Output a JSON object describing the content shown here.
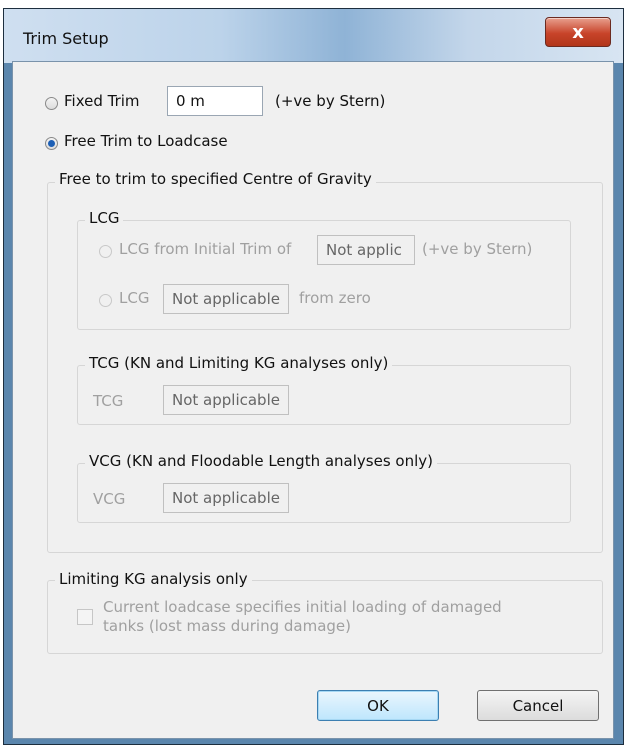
{
  "window": {
    "title": "Trim Setup",
    "close_label": "x"
  },
  "trim": {
    "fixed_label": "Fixed Trim",
    "fixed_value": "0 m",
    "fixed_note": "(+ve by Stern)",
    "free_label": "Free Trim to Loadcase",
    "selected": "free"
  },
  "cog_group": {
    "title": "Free to trim to specified Centre of Gravity",
    "lcg": {
      "title": "LCG",
      "from_trim_label": "LCG from Initial Trim of",
      "from_trim_value": "Not applic",
      "from_trim_note": "(+ve by Stern)",
      "lcg_label": "LCG",
      "lcg_value": "Not applicable",
      "lcg_note": "from zero"
    },
    "tcg": {
      "title": "TCG (KN and Limiting KG analyses only)",
      "label": "TCG",
      "value": "Not applicable"
    },
    "vcg": {
      "title": "VCG (KN and Floodable Length analyses only)",
      "label": "VCG",
      "value": "Not applicable"
    }
  },
  "limiting_kg": {
    "title": "Limiting KG analysis only",
    "checkbox_label_line1": "Current loadcase specifies initial loading of damaged",
    "checkbox_label_line2": "tanks (lost mass during damage)",
    "checked": false
  },
  "buttons": {
    "ok": "OK",
    "cancel": "Cancel"
  },
  "colors": {
    "frame": "#5b86ad",
    "client_bg": "#f0f0f0",
    "close_button": "#c8442a",
    "radio_selected": "#1d5fb5"
  }
}
